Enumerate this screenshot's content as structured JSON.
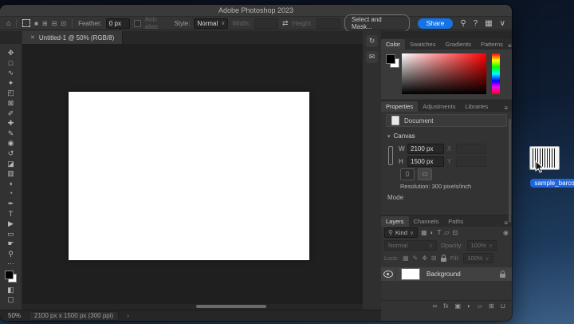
{
  "colors": {
    "accent_blue": "#1473e6",
    "selection_blue": "#1f66e0",
    "canvas_bg": "#1f1f1f"
  },
  "titlebar": {
    "title": "Adobe Photoshop 2023"
  },
  "options_bar": {
    "feather_label": "Feather:",
    "feather_value": "0 px",
    "anti_alias_label": "Anti-alias",
    "style_label": "Style:",
    "style_value": "Normal",
    "width_label": "Width:",
    "height_label": "Height:",
    "select_and_mask_label": "Select and Mask...",
    "share_label": "Share",
    "mode_icons": [
      {
        "name": "new-selection-icon",
        "glyph": "■"
      },
      {
        "name": "add-to-selection-icon",
        "glyph": "⊞"
      },
      {
        "name": "subtract-from-selection-icon",
        "glyph": "⊟"
      },
      {
        "name": "intersect-selection-icon",
        "glyph": "⊡"
      }
    ],
    "right_icons": [
      {
        "name": "search-icon",
        "glyph": "⚲"
      },
      {
        "name": "help-icon",
        "glyph": "?"
      },
      {
        "name": "workspace-icon",
        "glyph": "▦"
      },
      {
        "name": "chevron-down-icon",
        "glyph": "∨"
      }
    ]
  },
  "document_tab": {
    "close_glyph": "✕",
    "title": "Untitled-1 @ 50% (RGB/8)"
  },
  "toolbar": {
    "tools": [
      {
        "name": "move-tool",
        "glyph": "✥"
      },
      {
        "name": "rectangular-marquee-tool",
        "glyph": "□"
      },
      {
        "name": "lasso-tool",
        "glyph": "∿"
      },
      {
        "name": "object-selection-tool",
        "glyph": "✦"
      },
      {
        "name": "crop-tool",
        "glyph": "◰"
      },
      {
        "name": "frame-tool",
        "glyph": "⊠"
      },
      {
        "name": "eyedropper-tool",
        "glyph": "✐"
      },
      {
        "name": "spot-healing-brush-tool",
        "glyph": "✚"
      },
      {
        "name": "brush-tool",
        "glyph": "✎"
      },
      {
        "name": "clone-stamp-tool",
        "glyph": "◉"
      },
      {
        "name": "history-brush-tool",
        "glyph": "↺"
      },
      {
        "name": "eraser-tool",
        "glyph": "◪"
      },
      {
        "name": "gradient-tool",
        "glyph": "▥"
      },
      {
        "name": "blur-tool",
        "glyph": "◖"
      },
      {
        "name": "dodge-tool",
        "glyph": "◔"
      },
      {
        "name": "pen-tool",
        "glyph": "✒"
      },
      {
        "name": "type-tool",
        "glyph": "T"
      },
      {
        "name": "path-selection-tool",
        "glyph": "▶"
      },
      {
        "name": "rectangle-tool",
        "glyph": "▭"
      },
      {
        "name": "hand-tool",
        "glyph": "☛"
      },
      {
        "name": "zoom-tool",
        "glyph": "⚲"
      }
    ],
    "more_glyph": "⋯",
    "quick_mask_glyph": "◧",
    "screen_mode_glyph": "▢"
  },
  "dock_icons": [
    {
      "name": "history-panel-icon",
      "glyph": "↻"
    },
    {
      "name": "comments-panel-icon",
      "glyph": "✉"
    }
  ],
  "panels": {
    "color": {
      "tabs": [
        "Color",
        "Swatches",
        "Gradients",
        "Patterns"
      ],
      "menu_glyph": "≡"
    },
    "properties": {
      "tabs": [
        "Properties",
        "Adjustments",
        "Libraries"
      ],
      "menu_glyph": "≡",
      "document_label": "Document",
      "canvas_label": "Canvas",
      "w_label": "W",
      "w_value": "2100 px",
      "h_label": "H",
      "h_value": "1500 px",
      "x_label": "X",
      "y_label": "Y",
      "portrait_glyph": "▯",
      "landscape_glyph": "▭",
      "resolution_text": "Resolution: 300 pixels/inch",
      "mode_label": "Mode"
    },
    "layers": {
      "tabs": [
        "Layers",
        "Channels",
        "Paths"
      ],
      "menu_glyph": "≡",
      "kind_label": "Kind",
      "filter_icons": [
        {
          "name": "filter-pixel-layers-icon",
          "glyph": "▦"
        },
        {
          "name": "filter-adjustment-layers-icon",
          "glyph": "◐"
        },
        {
          "name": "filter-type-layers-icon",
          "glyph": "T"
        },
        {
          "name": "filter-shape-layers-icon",
          "glyph": "▱"
        },
        {
          "name": "filter-smart-objects-icon",
          "glyph": "⊡"
        }
      ],
      "filter_toggle_glyph": "◉",
      "blend_mode": "Normal",
      "opacity_label": "Opacity:",
      "opacity_value": "100%",
      "lock_label": "Lock:",
      "lock_icons": [
        {
          "name": "lock-transparent-pixels-icon",
          "glyph": "▦"
        },
        {
          "name": "lock-image-pixels-icon",
          "glyph": "✎"
        },
        {
          "name": "lock-position-icon",
          "glyph": "✥"
        },
        {
          "name": "lock-artboard-icon",
          "glyph": "⊞"
        }
      ],
      "fill_label": "Fill:",
      "fill_value": "100%",
      "layers": [
        {
          "name": "Background"
        }
      ],
      "footer_icons": [
        {
          "name": "link-layers-icon",
          "glyph": "∞"
        },
        {
          "name": "layer-effects-icon",
          "glyph": "fx"
        },
        {
          "name": "add-layer-mask-icon",
          "glyph": "▣"
        },
        {
          "name": "new-adjustment-layer-icon",
          "glyph": "◐"
        },
        {
          "name": "new-group-icon",
          "glyph": "▱"
        },
        {
          "name": "new-layer-icon",
          "glyph": "⊞"
        },
        {
          "name": "delete-layer-icon",
          "glyph": "⊔"
        }
      ]
    }
  },
  "status_bar": {
    "zoom": "50%",
    "doc_info": "2100 px x 1500 px (300 ppi)",
    "chevron_glyph": "›"
  },
  "desktop": {
    "file_label": "sample_barcode"
  }
}
